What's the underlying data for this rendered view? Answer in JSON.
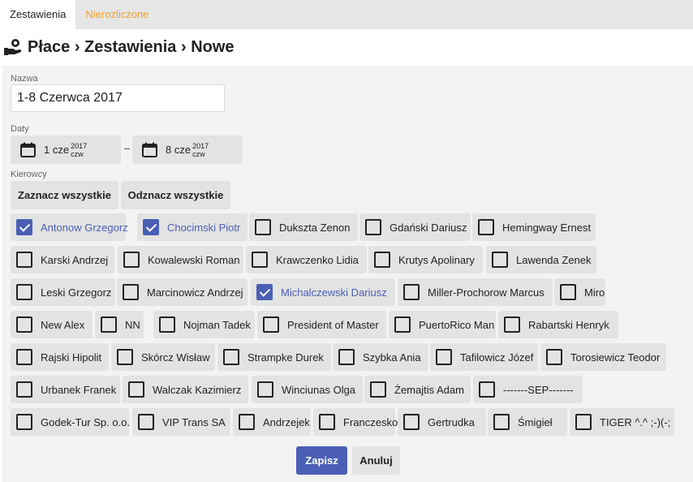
{
  "tabs": [
    {
      "label": "Zestawienia",
      "active": true
    },
    {
      "label": "Nierozliczone",
      "active": false
    }
  ],
  "page_title": "Płace › Zestawienia › Nowe",
  "form": {
    "name_label": "Nazwa",
    "name_value": "1-8 Czerwca 2017",
    "dates_label": "Daty",
    "date_from": {
      "day": "1 cze",
      "year": "2017",
      "weekday": "czw"
    },
    "date_separator": "–",
    "date_to": {
      "day": "8 cze",
      "year": "2017",
      "weekday": "czw"
    },
    "drivers_label": "Kierowcy",
    "select_all": "Zaznacz wszystkie",
    "deselect_all": "Odznacz wszystkie",
    "drivers": [
      {
        "label": "Antonow Grzegorz",
        "checked": true
      },
      {
        "label": "Chocimski Piotr",
        "checked": true
      },
      {
        "label": "Dukszta Zenon",
        "checked": false
      },
      {
        "label": "Gdański Dariusz",
        "checked": false
      },
      {
        "label": "Hemingway Ernest",
        "checked": false
      },
      {
        "label": "Karski Andrzej",
        "checked": false
      },
      {
        "label": "Kowalewski Roman",
        "checked": false
      },
      {
        "label": "Krawczenko Lidia",
        "checked": false
      },
      {
        "label": "Krutys Apolinary",
        "checked": false
      },
      {
        "label": "Lawenda Zenek",
        "checked": false
      },
      {
        "label": "Leski Grzegorz",
        "checked": false
      },
      {
        "label": "Marcinowicz Andrzej",
        "checked": false
      },
      {
        "label": "Michalczewski Dariusz",
        "checked": true
      },
      {
        "label": "Miller-Prochorow Marcus",
        "checked": false
      },
      {
        "label": "Miro",
        "checked": false
      },
      {
        "label": "New Alex",
        "checked": false
      },
      {
        "label": "NN",
        "checked": false
      },
      {
        "label": "Nojman Tadek",
        "checked": false
      },
      {
        "label": "President of Master",
        "checked": false
      },
      {
        "label": "PuertoRico Man",
        "checked": false
      },
      {
        "label": "Rabartski Henryk",
        "checked": false
      },
      {
        "label": "Rajski Hipolit",
        "checked": false
      },
      {
        "label": "Skórcz Wisław",
        "checked": false
      },
      {
        "label": "Strampke Durek",
        "checked": false
      },
      {
        "label": "Szybka Ania",
        "checked": false
      },
      {
        "label": "Tafilowicz Józef",
        "checked": false
      },
      {
        "label": "Torosiewicz Teodor",
        "checked": false
      },
      {
        "label": "Urbanek Franek",
        "checked": false
      },
      {
        "label": "Walczak Kazimierz",
        "checked": false
      },
      {
        "label": "Winciunas Olga",
        "checked": false
      },
      {
        "label": "Żemajtis Adam",
        "checked": false
      },
      {
        "label": "-------SEP-------",
        "checked": false
      },
      {
        "label": "Godek-Tur Sp. o.o.",
        "checked": false
      },
      {
        "label": "VIP Trans SA",
        "checked": false
      },
      {
        "label": "Andrzejek",
        "checked": false
      },
      {
        "label": "Franczesko",
        "checked": false
      },
      {
        "label": "Gertrudka",
        "checked": false
      },
      {
        "label": "Śmigieł",
        "checked": false
      },
      {
        "label": "TIGER ^.^ ;-)(-;",
        "checked": false
      }
    ],
    "save": "Zapisz",
    "cancel": "Anuluj"
  },
  "colors": {
    "accent": "#4a5fb5",
    "inactive_tab": "#f0a030",
    "chip_bg": "#e3e3e3",
    "panel_bg": "#f3f3f3"
  },
  "icons": {
    "title": "money-hand-icon",
    "calendar": "calendar-icon"
  }
}
